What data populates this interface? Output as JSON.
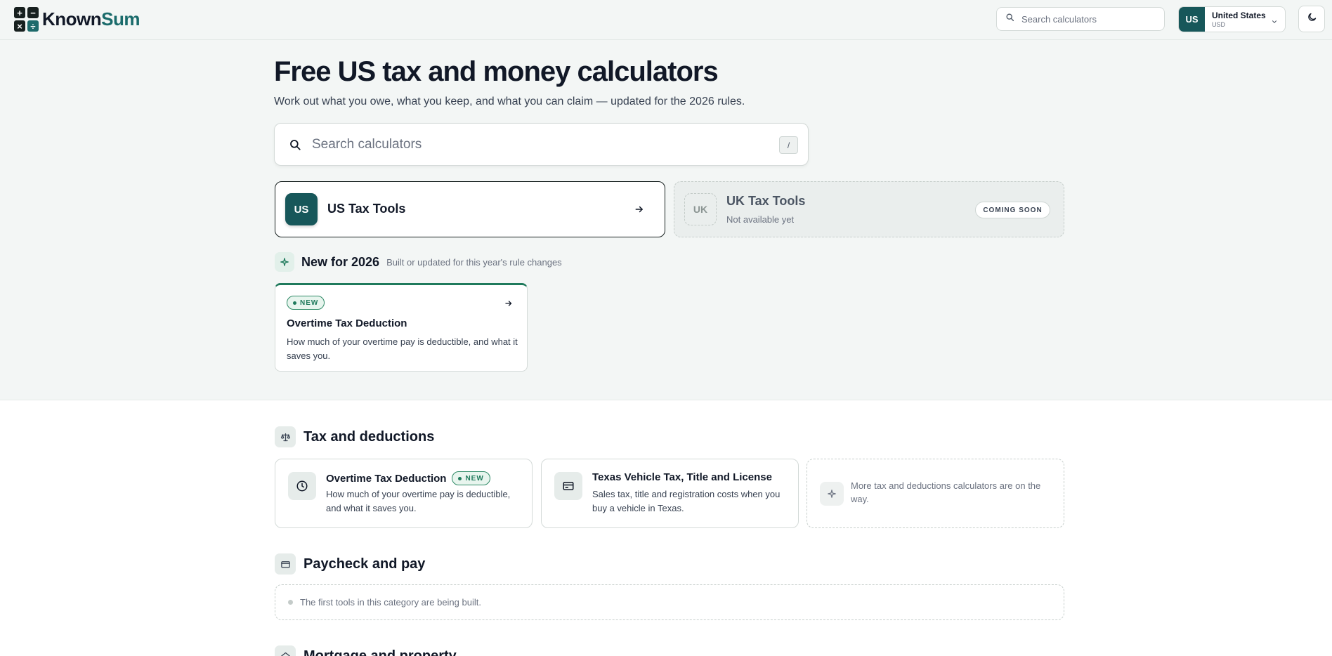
{
  "header": {
    "logo": {
      "part1": "Known",
      "part2": "Sum",
      "icon": "calculator-logo-icon"
    },
    "search": {
      "placeholder": "Search calculators",
      "icon": "search-icon"
    },
    "country": {
      "code": "US",
      "name": "United States",
      "currency": "USD"
    },
    "theme_toggle_icon": "moon-icon"
  },
  "hero": {
    "title": "Free US tax and money calculators",
    "subtitle": "Work out what you owe, what you keep, and what you can claim — updated for the 2026 rules.",
    "search": {
      "placeholder": "Search calculators",
      "shortcut": "/"
    },
    "tool_cards": [
      {
        "code": "US",
        "title": "US Tax Tools",
        "status": "active"
      },
      {
        "code": "UK",
        "title": "UK Tax Tools",
        "subtitle": "Not available yet",
        "badge": "COMING SOON",
        "status": "disabled"
      }
    ]
  },
  "new_section": {
    "title": "New for 2026",
    "description": "Built or updated for this year's rule changes",
    "icon": "sparkle-icon",
    "cards": [
      {
        "badge": "NEW",
        "title": "Overtime Tax Deduction",
        "description": "How much of your overtime pay is deductible, and what it saves you."
      }
    ]
  },
  "categories": [
    {
      "title": "Tax and deductions",
      "icon": "scale-icon",
      "cards": [
        {
          "icon": "clock-icon",
          "title": "Overtime Tax Deduction",
          "badge": "NEW",
          "description": "How much of your overtime pay is deductible, and what it saves you."
        },
        {
          "icon": "card-icon",
          "title": "Texas Vehicle Tax, Title and License",
          "description": "Sales tax, title and registration costs when you buy a vehicle in Texas."
        }
      ],
      "more_text": "More tax and deductions calculators are on the way."
    },
    {
      "title": "Paycheck and pay",
      "icon": "wallet-icon",
      "placeholder": "The first tools in this category are being built."
    },
    {
      "title": "Mortgage and property",
      "icon": "house-icon"
    }
  ],
  "colors": {
    "brand": "#17575a",
    "brand_text": "#1a6b6b",
    "new_green": "#1f7a5c",
    "hero_bg": "#f3f6f5"
  }
}
